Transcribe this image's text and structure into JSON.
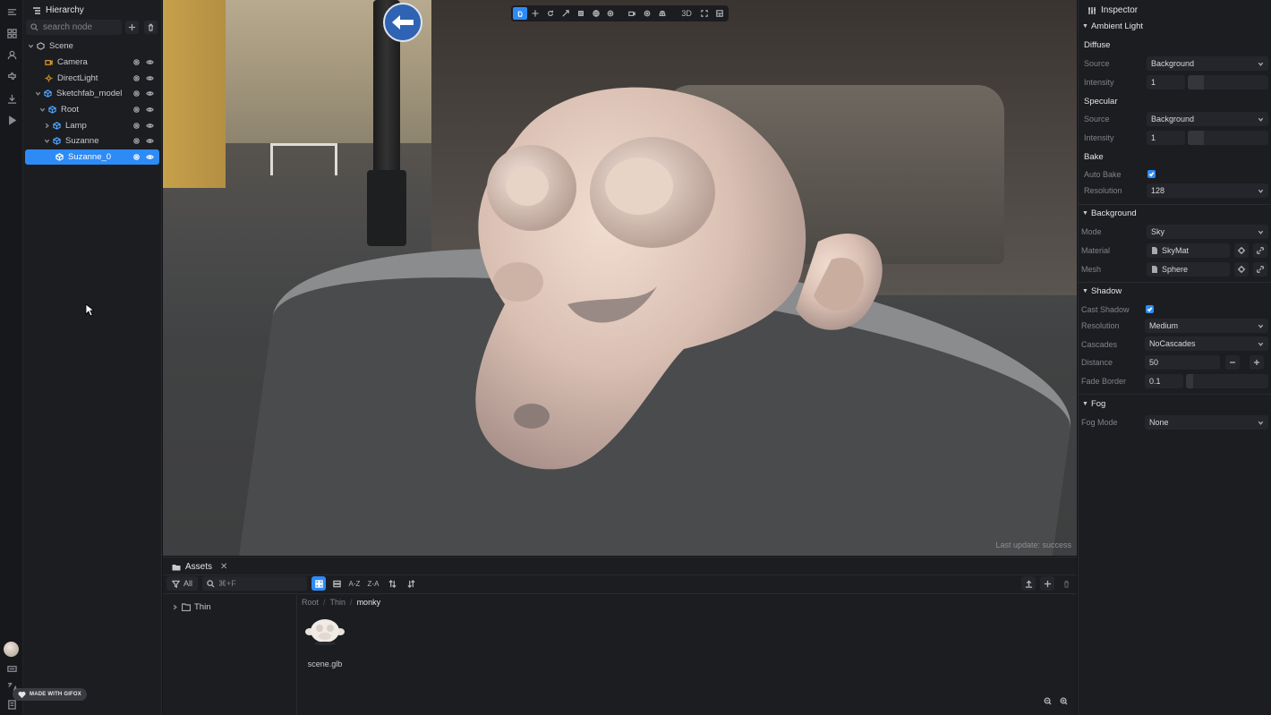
{
  "hierarchy": {
    "tab_label": "Hierarchy",
    "search_placeholder": "search node",
    "nodes": [
      {
        "label": "Scene",
        "icon": "scene-icon"
      },
      {
        "label": "Camera",
        "icon": "camera-icon"
      },
      {
        "label": "DirectLight",
        "icon": "light-icon"
      },
      {
        "label": "Sketchfab_model",
        "icon": "entity-icon"
      },
      {
        "label": "Root",
        "icon": "entity-icon"
      },
      {
        "label": "Lamp",
        "icon": "entity-icon"
      },
      {
        "label": "Suzanne",
        "icon": "entity-icon"
      },
      {
        "label": "Suzanne_0",
        "icon": "mesh-icon",
        "selected": true
      }
    ]
  },
  "viewport": {
    "toolbar": {
      "mode_3d": "3D"
    },
    "status": "Last update: success"
  },
  "inspector": {
    "tab_label": "Inspector",
    "ambient": {
      "title": "Ambient Light",
      "diffuse_title": "Diffuse",
      "diffuse_source_label": "Source",
      "diffuse_source_value": "Background",
      "diffuse_intensity_label": "Intensity",
      "diffuse_intensity_value": "1",
      "specular_title": "Specular",
      "specular_source_label": "Source",
      "specular_source_value": "Background",
      "specular_intensity_label": "Intensity",
      "specular_intensity_value": "1",
      "bake_title": "Bake",
      "auto_bake_label": "Auto Bake",
      "auto_bake_checked": true,
      "resolution_label": "Resolution",
      "resolution_value": "128"
    },
    "background": {
      "title": "Background",
      "mode_label": "Mode",
      "mode_value": "Sky",
      "material_label": "Material",
      "material_value": "SkyMat",
      "mesh_label": "Mesh",
      "mesh_value": "Sphere"
    },
    "shadow": {
      "title": "Shadow",
      "cast_label": "Cast Shadow",
      "cast_checked": true,
      "resolution_label": "Resolution",
      "resolution_value": "Medium",
      "cascades_label": "Cascades",
      "cascades_value": "NoCascades",
      "distance_label": "Distance",
      "distance_value": "50",
      "fade_label": "Fade Border",
      "fade_value": "0.1"
    },
    "fog": {
      "title": "Fog",
      "mode_label": "Fog Mode",
      "mode_value": "None"
    }
  },
  "assets": {
    "tab_label": "Assets",
    "filter_label": "All",
    "search_placeholder": "⌘+F",
    "sort_az": "A-Z",
    "sort_za": "Z-A",
    "tree_folder": "Thin",
    "breadcrumb": [
      "Root",
      "Thin",
      "monky"
    ],
    "breadcrumb_sep": "/",
    "files": [
      {
        "name": "scene.glb",
        "icon": "model-thumbnail"
      }
    ]
  },
  "watermark": "MADE WITH GIFOX",
  "colors": {
    "accent": "#2e8bf5",
    "panel": "#1c1d21",
    "field": "#25262b"
  }
}
